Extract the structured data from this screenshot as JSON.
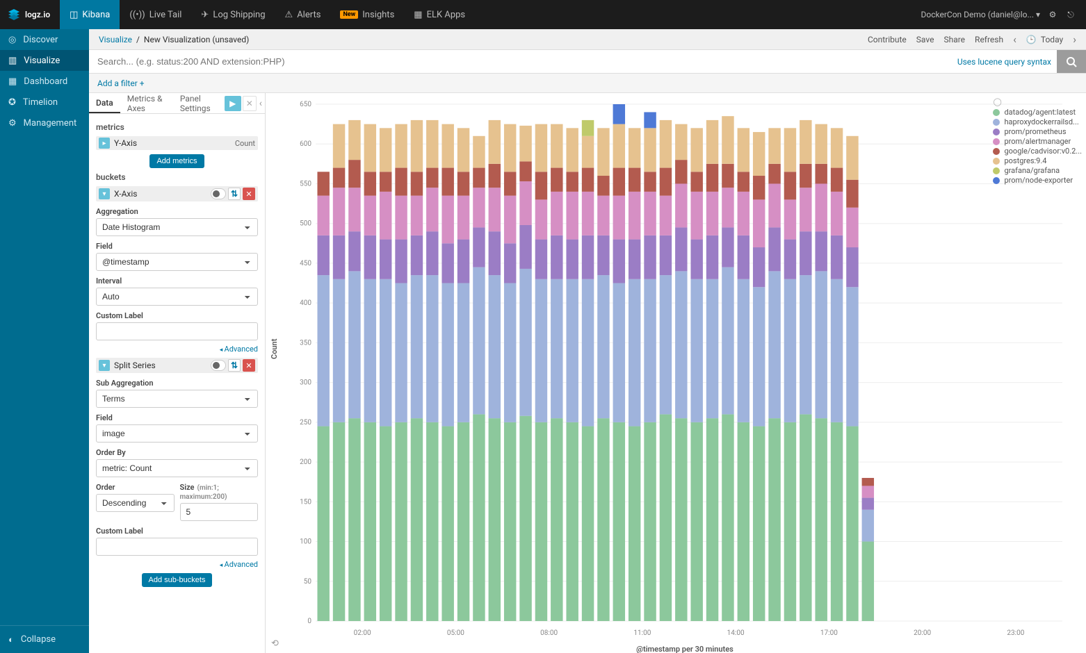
{
  "app": {
    "name": "logz.io",
    "account": "DockerCon Demo (daniel@lo...",
    "account_caret": "▾"
  },
  "topnav": {
    "items": [
      "Kibana",
      "Live Tail",
      "Log Shipping",
      "Alerts",
      "Insights",
      "ELK Apps"
    ],
    "insights_badge": "New"
  },
  "sidenav": {
    "items": [
      "Discover",
      "Visualize",
      "Dashboard",
      "Timelion",
      "Management"
    ],
    "active": 1,
    "collapse": "Collapse"
  },
  "breadcrumb": {
    "root": "Visualize",
    "sep": "/",
    "current": "New Visualization (unsaved)"
  },
  "actions": {
    "contribute": "Contribute",
    "save": "Save",
    "share": "Share",
    "refresh": "Refresh",
    "range_icon": "🕒",
    "range": "Today"
  },
  "search": {
    "placeholder": "Search... (e.g. status:200 AND extension:PHP)",
    "hint": "Uses lucene query syntax"
  },
  "filter": {
    "add": "Add a filter +"
  },
  "config_tabs": {
    "tabs": [
      "Data",
      "Metrics & Axes",
      "Panel Settings"
    ],
    "active": 0
  },
  "config": {
    "metrics_title": "metrics",
    "yaxis": "Y-Axis",
    "yaxis_value": "Count",
    "add_metrics": "Add metrics",
    "buckets_title": "buckets",
    "xaxis": "X-Axis",
    "aggregation_label": "Aggregation",
    "aggregation_value": "Date Histogram",
    "field_label": "Field",
    "field_value": "@timestamp",
    "interval_label": "Interval",
    "interval_value": "Auto",
    "custom_label": "Custom Label",
    "advanced": "Advanced",
    "split_series": "Split Series",
    "subagg_label": "Sub Aggregation",
    "subagg_value": "Terms",
    "field2_label": "Field",
    "field2_value": "image",
    "orderby_label": "Order By",
    "orderby_value": "metric: Count",
    "order_label": "Order",
    "order_value": "Descending",
    "size_label": "Size",
    "size_hint": "(min:1; maximum:200)",
    "size_value": "5",
    "custom_label2": "Custom Label",
    "add_sub": "Add sub-buckets"
  },
  "chart_data": {
    "type": "bar",
    "ylabel": "Count",
    "xlabel": "@timestamp per 30 minutes",
    "ylim": [
      0,
      650
    ],
    "yticks": [
      0,
      50,
      100,
      150,
      200,
      250,
      300,
      350,
      400,
      450,
      500,
      550,
      600,
      650
    ],
    "xticks": [
      "02:00",
      "05:00",
      "08:00",
      "11:00",
      "14:00",
      "17:00",
      "20:00",
      "23:00"
    ],
    "legend_meta": "◯",
    "series": [
      {
        "name": "datadog/agent:latest",
        "color": "#8cc89c"
      },
      {
        "name": "haproxydockerrailsd...",
        "color": "#9fb3dc"
      },
      {
        "name": "prom/prometheus",
        "color": "#9b7dc5"
      },
      {
        "name": "prom/alertmanager",
        "color": "#d68fc4"
      },
      {
        "name": "google/cadvisor:v0.2...",
        "color": "#b35b4f"
      },
      {
        "name": "postgres:9.4",
        "color": "#e6c28f"
      },
      {
        "name": "grafana/grafana",
        "color": "#bfca6a"
      },
      {
        "name": "prom/node-exporter",
        "color": "#4e79d6"
      }
    ],
    "stacks": [
      [
        245,
        190,
        50,
        50,
        30,
        0,
        0,
        0
      ],
      [
        250,
        180,
        55,
        60,
        25,
        55,
        0,
        0
      ],
      [
        255,
        185,
        50,
        55,
        35,
        50,
        0,
        0
      ],
      [
        250,
        180,
        55,
        50,
        30,
        60,
        0,
        0
      ],
      [
        245,
        185,
        50,
        60,
        25,
        55,
        0,
        0
      ],
      [
        250,
        175,
        55,
        55,
        35,
        55,
        0,
        0
      ],
      [
        255,
        180,
        50,
        50,
        30,
        65,
        0,
        0
      ],
      [
        250,
        185,
        55,
        55,
        25,
        60,
        0,
        0
      ],
      [
        245,
        180,
        50,
        60,
        35,
        55,
        0,
        0
      ],
      [
        250,
        175,
        55,
        55,
        30,
        55,
        0,
        0
      ],
      [
        260,
        185,
        50,
        50,
        25,
        40,
        0,
        0
      ],
      [
        255,
        180,
        55,
        55,
        30,
        55,
        0,
        0
      ],
      [
        250,
        175,
        50,
        60,
        30,
        60,
        0,
        0
      ],
      [
        258,
        185,
        55,
        55,
        25,
        45,
        0,
        0
      ],
      [
        250,
        180,
        50,
        50,
        35,
        60,
        0,
        0
      ],
      [
        255,
        175,
        55,
        55,
        30,
        55,
        0,
        0
      ],
      [
        250,
        180,
        50,
        60,
        25,
        55,
        0,
        0
      ],
      [
        245,
        185,
        55,
        55,
        30,
        40,
        20,
        0
      ],
      [
        255,
        180,
        50,
        50,
        25,
        60,
        0,
        0
      ],
      [
        250,
        175,
        55,
        55,
        35,
        55,
        0,
        25
      ],
      [
        245,
        185,
        50,
        60,
        30,
        50,
        0,
        0
      ],
      [
        250,
        180,
        55,
        55,
        25,
        55,
        0,
        20
      ],
      [
        260,
        175,
        50,
        50,
        35,
        60,
        0,
        0
      ],
      [
        255,
        185,
        55,
        55,
        30,
        45,
        0,
        0
      ],
      [
        250,
        180,
        50,
        60,
        25,
        55,
        0,
        0
      ],
      [
        255,
        175,
        55,
        55,
        35,
        55,
        0,
        0
      ],
      [
        260,
        185,
        50,
        50,
        30,
        60,
        0,
        0
      ],
      [
        250,
        180,
        55,
        55,
        25,
        55,
        0,
        0
      ],
      [
        245,
        175,
        50,
        60,
        30,
        55,
        0,
        0
      ],
      [
        255,
        185,
        55,
        55,
        25,
        45,
        0,
        0
      ],
      [
        250,
        180,
        50,
        50,
        35,
        55,
        0,
        0
      ],
      [
        260,
        175,
        55,
        55,
        30,
        55,
        0,
        0
      ],
      [
        255,
        185,
        50,
        60,
        25,
        50,
        0,
        0
      ],
      [
        250,
        180,
        55,
        55,
        30,
        50,
        0,
        0
      ],
      [
        245,
        175,
        50,
        50,
        35,
        55,
        0,
        0
      ],
      [
        100,
        40,
        15,
        15,
        10,
        0,
        0,
        0
      ]
    ]
  }
}
